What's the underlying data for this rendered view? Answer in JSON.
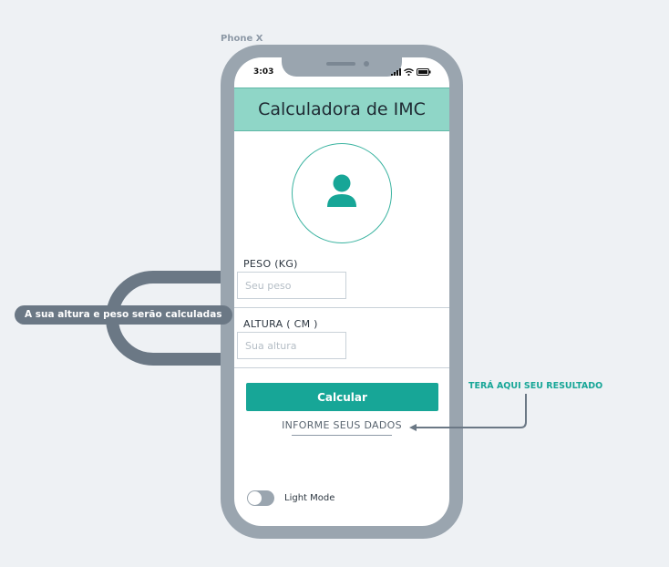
{
  "canvas": {
    "device_label": "Phone X"
  },
  "status_bar": {
    "time": "3:03"
  },
  "header": {
    "title": "Calculadora de IMC"
  },
  "form": {
    "weight": {
      "label": "PESO (KG)",
      "placeholder": "Seu peso",
      "value": ""
    },
    "height": {
      "label": "ALTURA ( CM )",
      "placeholder": "Sua altura",
      "value": ""
    },
    "calculate_label": "Calcular"
  },
  "result": {
    "text": "INFORME SEUS DADOS"
  },
  "settings": {
    "mode_label": "Light Mode",
    "mode_on": false
  },
  "annotations": {
    "inputs_note": "A sua altura e peso serão calculadas",
    "result_note": "TERÁ AQUI SEU RESULTADO"
  },
  "colors": {
    "accent": "#17a697",
    "header_bg": "#8fd6c7",
    "frame": "#9aa5af",
    "annotation": "#6b7885"
  }
}
